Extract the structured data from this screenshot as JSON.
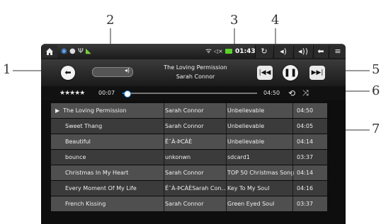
{
  "callouts": [
    "1",
    "2",
    "3",
    "4",
    "5",
    "6",
    "7"
  ],
  "status_bar": {
    "time": "01:43",
    "home_icon": "home-icon",
    "icons": [
      "media-icon",
      "bluetooth-icon",
      "usb-icon",
      "phone-icon",
      "wifi-icon",
      "mute-icon",
      "battery-icon"
    ],
    "buttons": [
      "refresh-icon",
      "volume-down-icon",
      "volume-up-icon",
      "back-arrow-icon",
      "menu-icon"
    ]
  },
  "player": {
    "track_title": "The Loving Permission",
    "track_artist": "Sarah Connor",
    "back_button": "back-icon",
    "volume_icon": "speaker-icon",
    "prev_button": "previous-icon",
    "pause_button": "pause-icon",
    "next_button": "next-icon",
    "rating": "★★★★★",
    "elapsed": "00:07",
    "total": "04:50",
    "progress_fraction": 0.03,
    "repeat_icon": "repeat-icon",
    "shuffle_icon": "shuffle-icon"
  },
  "tracks": [
    {
      "playing": true,
      "title": "The Loving Permission",
      "artist": "Sarah Connor",
      "album": "Unbelievable",
      "duration": "04:50"
    },
    {
      "playing": false,
      "title": "Sweet Thang",
      "artist": "Sarah Connor",
      "album": "Unbelievable",
      "duration": "04:05"
    },
    {
      "playing": false,
      "title": "Beautiful",
      "artist": "Ë¯À-ÞCÀÈ",
      "album": "Unbelievable",
      "duration": "04:14"
    },
    {
      "playing": false,
      "title": "bounce",
      "artist": "unkonwn",
      "album": "sdcard1",
      "duration": "03:37"
    },
    {
      "playing": false,
      "title": "Christmas In My Heart",
      "artist": "Sarah Connor",
      "album": "TOP 50 Christmas Song",
      "duration": "04:14"
    },
    {
      "playing": false,
      "title": "Every Moment Of My Life",
      "artist": "Ë¯À-ÞCÀÈSarah Con...",
      "album": "Key To My Soul",
      "duration": "04:16"
    },
    {
      "playing": false,
      "title": "French Kissing",
      "artist": "Sarah Connor",
      "album": "Green Eyed Soul",
      "duration": "03:37"
    }
  ],
  "playing_marker": "▶"
}
